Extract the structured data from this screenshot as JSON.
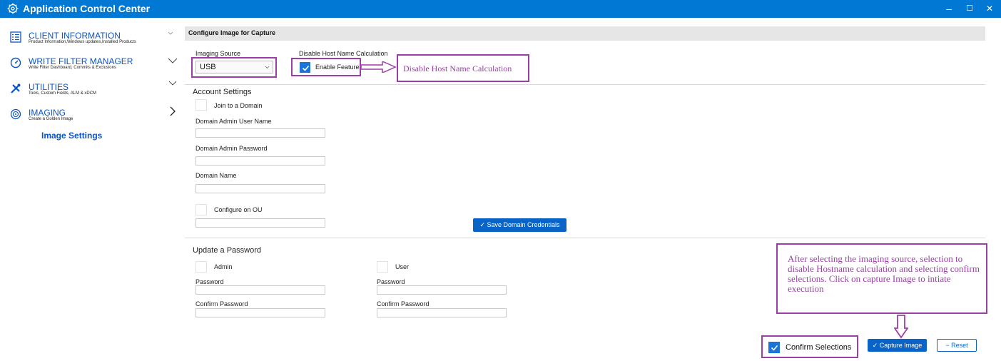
{
  "window": {
    "title": "Application Control Center",
    "controls": {
      "minimize": "–",
      "maximize": "☐",
      "close": "✕"
    }
  },
  "sidebar": {
    "items": [
      {
        "title": "CLIENT INFORMATION",
        "subtitle": "Product Information,Windows updates,Installed Products",
        "icon": "client-info-icon"
      },
      {
        "title": "WRITE FILTER MANAGER",
        "subtitle": "Write Filter Dashboard, Commits & Exclusions",
        "icon": "gauge-icon"
      },
      {
        "title": "UTILITIES",
        "subtitle": "Tools, Custom Fields, ALM & xDCM",
        "icon": "tools-icon"
      },
      {
        "title": "IMAGING",
        "subtitle": "Create a Golden Image",
        "icon": "disc-icon"
      }
    ],
    "sub_item": "Image Settings"
  },
  "main": {
    "header": "Configure Image for Capture",
    "imaging_source": {
      "label": "Imaging Source",
      "value": "USB"
    },
    "host_name": {
      "label": "Disable Host Name Calculation",
      "checkbox_label": "Enable Feature",
      "checked": true
    },
    "account": {
      "title": "Account Settings",
      "join_domain": "Join to a Domain",
      "admin_user_label": "Domain Admin User Name",
      "admin_pass_label": "Domain Admin Password",
      "domain_name_label": "Domain Name",
      "configure_ou": "Configure on OU",
      "save_button": "✓ Save Domain Credentials"
    },
    "password": {
      "title": "Update a Password",
      "admin": "Admin",
      "user": "User",
      "password_label": "Password",
      "confirm_label": "Confirm Password"
    },
    "confirm_selections": {
      "label": "Confirm Selections",
      "checked": true
    },
    "capture_button": "✓ Capture Image",
    "reset_button": "Reset",
    "reset_icon": "minus-icon"
  },
  "annotations": {
    "host_name_note": "Disable Host Name Calculation",
    "instructions": "After selecting the imaging source, selection to disable Hostname calculation and selecting confirm selections. Click on capture Image to intiate execution"
  },
  "colors": {
    "titlebar": "#0078d4",
    "accent": "#0a64c8",
    "annotation": "#9b3fa6"
  }
}
